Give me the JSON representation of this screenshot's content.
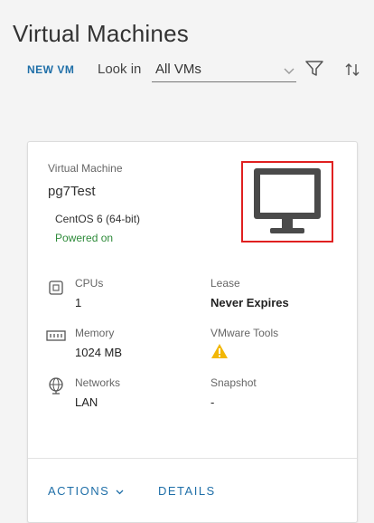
{
  "page": {
    "title": "Virtual Machines"
  },
  "toolbar": {
    "new_vm_label": "NEW VM",
    "look_in_label": "Look in",
    "look_in_value": "All VMs"
  },
  "card": {
    "label": "Virtual Machine",
    "name": "pg7Test",
    "os": "CentOS 6 (64-bit)",
    "power_state": "Powered on",
    "fields": {
      "cpus": {
        "label": "CPUs",
        "value": "1"
      },
      "memory": {
        "label": "Memory",
        "value": "1024 MB"
      },
      "networks": {
        "label": "Networks",
        "value": "LAN"
      },
      "lease": {
        "label": "Lease",
        "value": "Never Expires"
      },
      "vmware_tools": {
        "label": "VMware Tools",
        "status_icon": "warning-icon"
      },
      "snapshot": {
        "label": "Snapshot",
        "value": "-"
      }
    },
    "actions_label": "ACTIONS",
    "details_label": "DETAILS"
  },
  "colors": {
    "accent": "#1f6fa8",
    "powered_on": "#2e8b3a",
    "warning": "#f2b705",
    "highlight_border": "#e02020"
  }
}
